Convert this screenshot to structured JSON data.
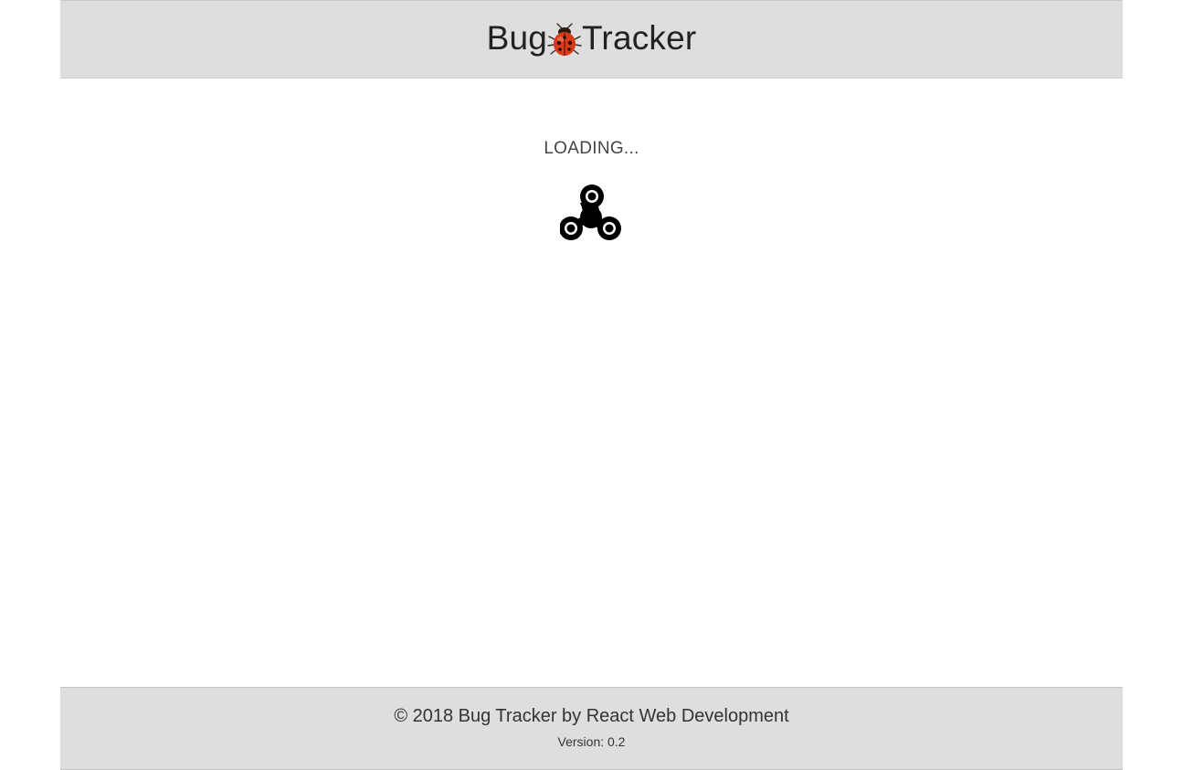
{
  "header": {
    "brand_left": "Bug",
    "brand_right": "Tracker",
    "logo_icon": "ladybug-icon"
  },
  "main": {
    "loading_text": "LOADING...",
    "spinner_icon": "fidget-spinner-icon"
  },
  "footer": {
    "copyright": "© 2018 Bug Tracker by React Web Development",
    "version_label": "Version: 0.2"
  },
  "colors": {
    "header_bg": "#dedede",
    "footer_bg": "#dedede",
    "page_bg": "#ffffff",
    "ladybug_red": "#d93a1c",
    "spinner": "#000000"
  }
}
